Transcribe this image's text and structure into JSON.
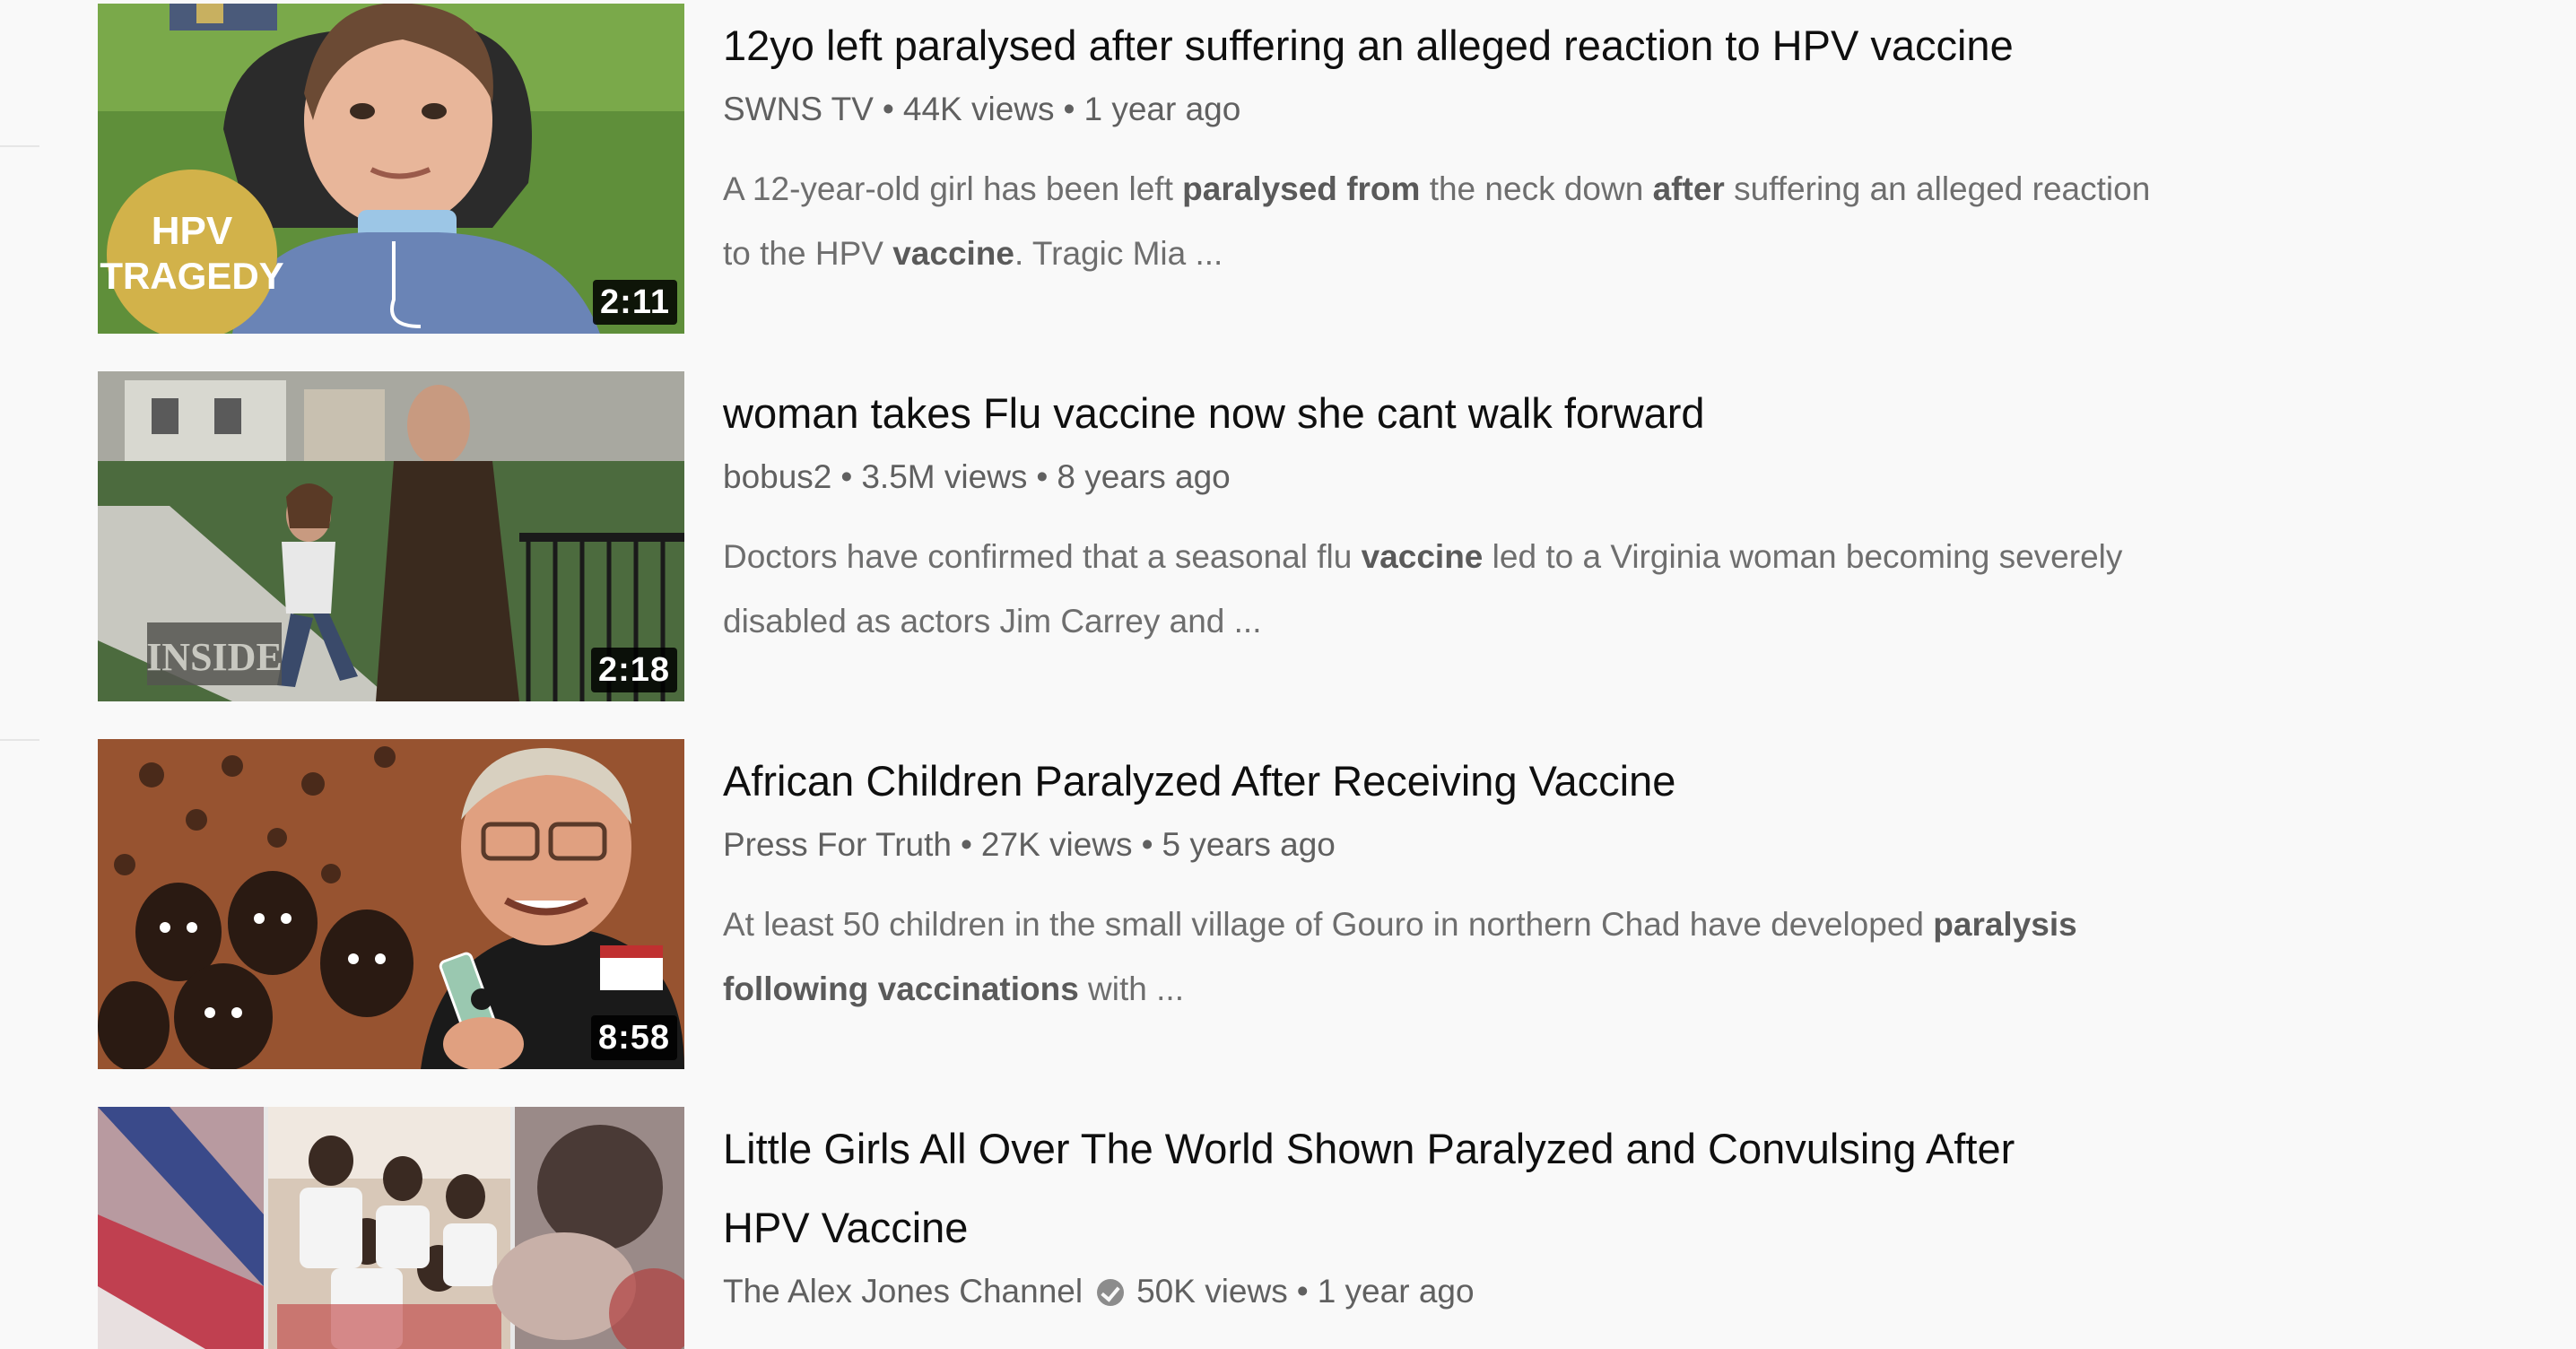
{
  "results": [
    {
      "title": "12yo left paralysed after suffering an alleged reaction to HPV vaccine",
      "channel": "SWNS TV",
      "views": "44K views",
      "age": "1 year ago",
      "duration": "2:11",
      "thumb_badge_line1": "HPV",
      "thumb_badge_line2": "TRAGEDY",
      "description": {
        "line1": [
          {
            "t": "A 12-year-old girl has been left ",
            "b": false
          },
          {
            "t": "paralysed from",
            "b": true
          },
          {
            "t": " the neck down ",
            "b": false
          },
          {
            "t": "after",
            "b": true
          },
          {
            "t": " suffering an alleged reaction",
            "b": false
          }
        ],
        "line2": [
          {
            "t": "to the HPV ",
            "b": false
          },
          {
            "t": "vaccine",
            "b": true
          },
          {
            "t": ". Tragic Mia ...",
            "b": false
          }
        ]
      }
    },
    {
      "title": "woman takes Flu vaccine now she cant walk forward",
      "channel": "bobus2",
      "views": "3.5M views",
      "age": "8 years ago",
      "duration": "2:18",
      "thumb_logo": "INSIDE",
      "description": {
        "line1": [
          {
            "t": "Doctors have confirmed that a seasonal flu ",
            "b": false
          },
          {
            "t": "vaccine",
            "b": true
          },
          {
            "t": " led to a Virginia woman becoming severely",
            "b": false
          }
        ],
        "line2": [
          {
            "t": "disabled as actors Jim Carrey and ...",
            "b": false
          }
        ]
      }
    },
    {
      "title": "African Children Paralyzed After Receiving Vaccine",
      "channel": "Press For Truth",
      "views": "27K views",
      "age": "5 years ago",
      "duration": "8:58",
      "description": {
        "line1": [
          {
            "t": "At least 50 children in the small village of Gouro in northern Chad have developed ",
            "b": false
          },
          {
            "t": "paralysis",
            "b": true
          }
        ],
        "line2": [
          {
            "t": "following vaccinations",
            "b": true
          },
          {
            "t": " with ...",
            "b": false
          }
        ]
      }
    },
    {
      "title_line1": "Little Girls All Over The World Shown Paralyzed and Convulsing After",
      "title_line2": "HPV Vaccine",
      "channel": "The Alex Jones Channel",
      "verified": true,
      "views": "50K views",
      "age": "1 year ago"
    }
  ],
  "colors": {
    "background": "#f9f9f9",
    "title": "#0f0f0f",
    "meta": "#606060",
    "description": "#6e6e6e"
  }
}
